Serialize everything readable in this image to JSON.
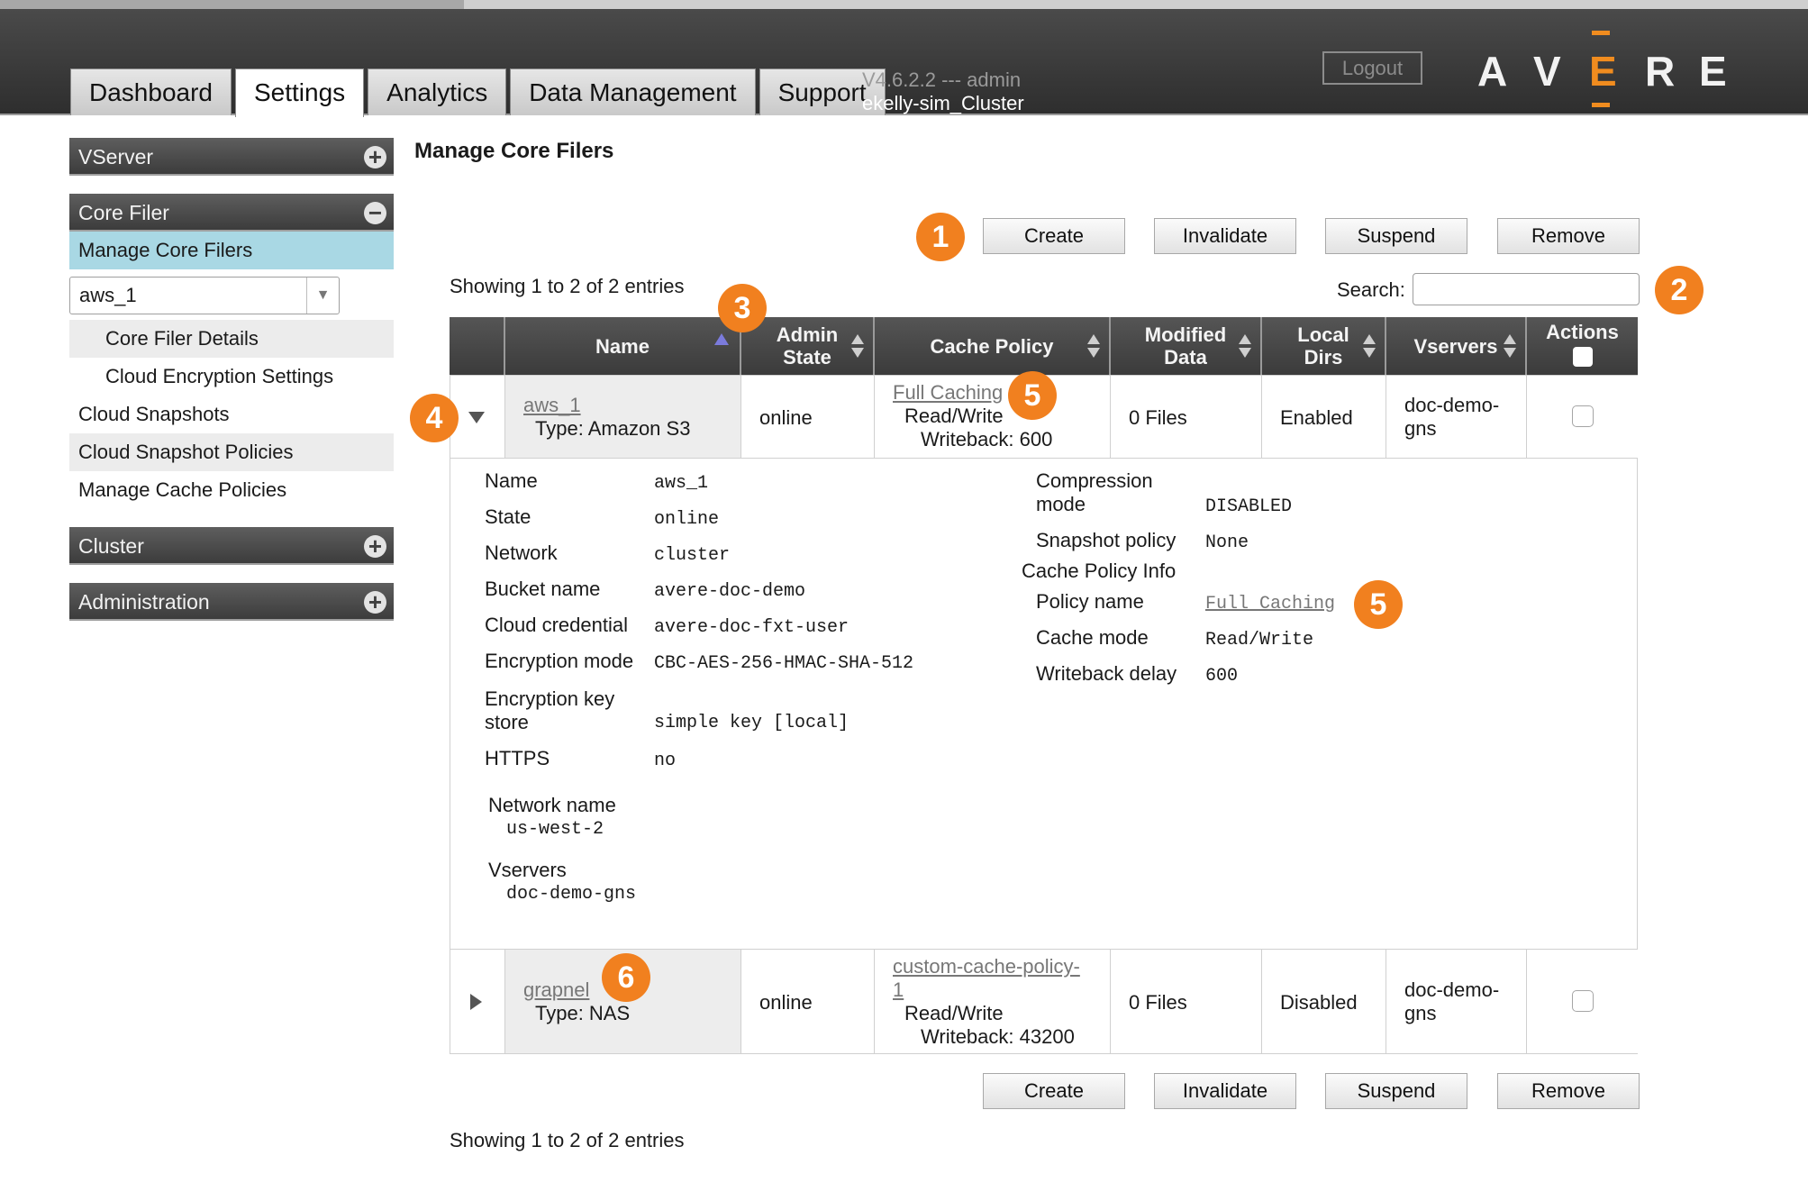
{
  "header": {
    "tabs": [
      {
        "label": "Dashboard"
      },
      {
        "label": "Settings"
      },
      {
        "label": "Analytics"
      },
      {
        "label": "Data Management"
      },
      {
        "label": "Support"
      }
    ],
    "version": "V4.6.2.2 --- admin",
    "cluster": "ekelly-sim_Cluster",
    "logout_label": "Logout",
    "logo_letters": [
      "A",
      "V",
      "E",
      "R",
      "E"
    ],
    "accent_color": "#f08c1f"
  },
  "sidebar": {
    "vserver": "VServer",
    "core_filer": "Core Filer",
    "manage_core_filers": "Manage Core Filers",
    "filer_select_value": "aws_1",
    "core_filer_details": "Core Filer Details",
    "cloud_encryption_settings": "Cloud Encryption Settings",
    "cloud_snapshots": "Cloud Snapshots",
    "cloud_snapshot_policies": "Cloud Snapshot Policies",
    "manage_cache_policies": "Manage Cache Policies",
    "cluster": "Cluster",
    "administration": "Administration",
    "plus": "+",
    "minus": "−"
  },
  "main": {
    "title": "Manage Core Filers",
    "buttons": {
      "create": "Create",
      "invalidate": "Invalidate",
      "suspend": "Suspend",
      "remove": "Remove"
    },
    "showing": "Showing 1 to 2 of 2 entries",
    "search_label": "Search:",
    "columns": {
      "name": "Name",
      "admin_state_1": "Admin",
      "admin_state_2": "State",
      "cache_policy": "Cache Policy",
      "modified_1": "Modified",
      "modified_2": "Data",
      "local_1": "Local",
      "local_2": "Dirs",
      "vservers": "Vservers",
      "actions": "Actions"
    },
    "rows": [
      {
        "name": "aws_1",
        "type": "Type: Amazon S3",
        "state": "online",
        "policy": "Full Caching",
        "mode": "Read/Write",
        "writeback": "Writeback: 600",
        "modified": "0 Files",
        "local": "Enabled",
        "vservers_1": "doc-demo-",
        "vservers_2": "gns"
      },
      {
        "name": "grapnel",
        "type": "Type: NAS",
        "state": "online",
        "policy_1": "custom-cache-policy-",
        "policy_2": "1",
        "mode": "Read/Write",
        "writeback": "Writeback: 43200",
        "modified": "0 Files",
        "local": "Disabled",
        "vservers_1": "doc-demo-",
        "vservers_2": "gns"
      }
    ],
    "details": {
      "left": [
        {
          "label": "Name",
          "value": "aws_1"
        },
        {
          "label": "State",
          "value": "online"
        },
        {
          "label": "Network",
          "value": "cluster"
        },
        {
          "label": "Bucket name",
          "value": "avere-doc-demo"
        },
        {
          "label": "Cloud credential",
          "value": "avere-doc-fxt-user"
        },
        {
          "label": "Encryption mode",
          "value": "CBC-AES-256-HMAC-SHA-512"
        },
        {
          "label_1": "Encryption key",
          "label_2": "store",
          "value": "simple key [local]"
        },
        {
          "label": "HTTPS",
          "value": "no"
        }
      ],
      "network_name_label": "Network name",
      "network_name_value": "us-west-2",
      "vservers_label": "Vservers",
      "vservers_value": "doc-demo-gns",
      "right": {
        "compression_1": "Compression",
        "compression_2": "mode",
        "compression_value": "DISABLED",
        "snapshot_label": "Snapshot policy",
        "snapshot_value": "None",
        "cache_info": "Cache Policy Info",
        "policy_name_label": "Policy name",
        "policy_name_value": "Full Caching",
        "cache_mode_label": "Cache mode",
        "cache_mode_value": "Read/Write",
        "writeback_label": "Writeback delay",
        "writeback_value": "600"
      }
    }
  },
  "callouts": [
    "1",
    "2",
    "3",
    "4",
    "5",
    "5",
    "6"
  ],
  "callout_color": "#f1801f"
}
